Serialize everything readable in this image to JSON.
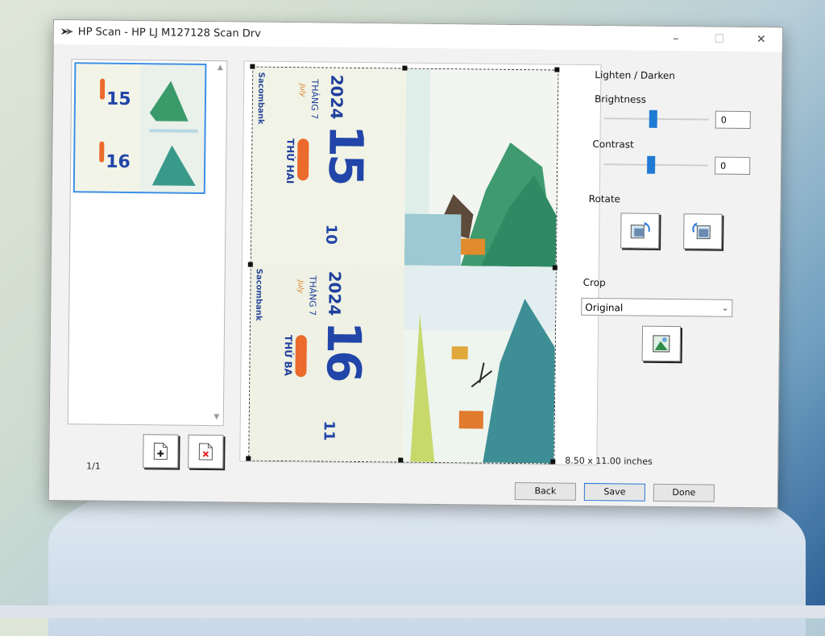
{
  "window": {
    "title": "HP Scan - HP LJ M127128 Scan Drv",
    "minimize": "–",
    "maximize": "☐",
    "close": "✕"
  },
  "thumbnails": {
    "page_count": "1/1"
  },
  "preview": {
    "top": {
      "bank": "Sacombank",
      "year": "2024",
      "month": "THÁNG 7",
      "month_en": "July",
      "day_label": "THỨ HAI",
      "day_num": "15",
      "lunar": "10"
    },
    "bottom": {
      "bank": "Sacombank",
      "year": "2024",
      "month": "THÁNG 7",
      "month_en": "July",
      "day_label": "THỨ BA",
      "day_num": "16",
      "lunar": "11"
    }
  },
  "controls": {
    "lighten_darken": "Lighten / Darken",
    "brightness_label": "Brightness",
    "brightness_value": "0",
    "contrast_label": "Contrast",
    "contrast_value": "0",
    "rotate_label": "Rotate",
    "crop_label": "Crop",
    "crop_selected": "Original",
    "dimensions": "8.50 x 11.00 inches"
  },
  "buttons": {
    "back": "Back",
    "save": "Save",
    "done": "Done"
  },
  "icons": {
    "add_page": "add-page-icon",
    "delete_page": "delete-page-icon",
    "rotate_left": "rotate-left-icon",
    "rotate_right": "rotate-right-icon",
    "crop": "crop-image-icon"
  }
}
